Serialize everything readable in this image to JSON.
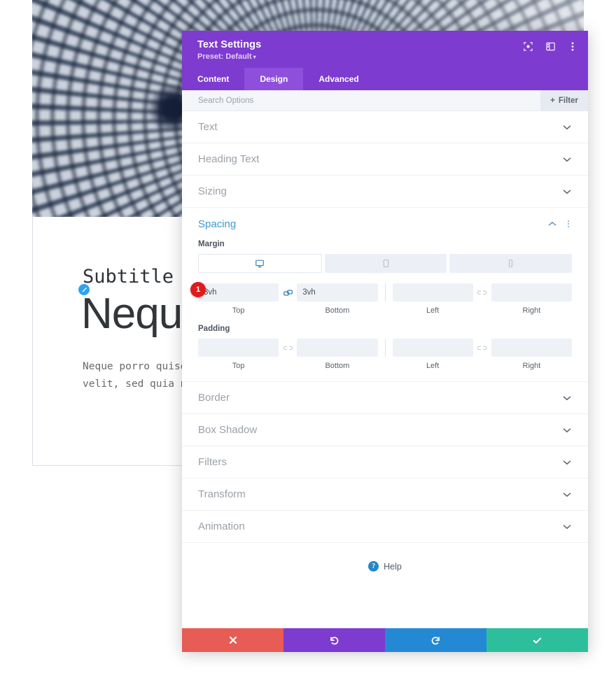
{
  "background": {
    "subtitle": "Subtitle",
    "heading": "Neque",
    "body_line1": "Neque porro quisquam est qui dolorem ipsum quia dolor sit amet, consectetur,",
    "body_line2": "velit, sed quia non numquam eius modi tempora incidunt ut labore.",
    "edit_badge_icon": "pencil-icon",
    "hero_image_alt": "blurred-dome-ceiling-photo"
  },
  "modal": {
    "title": "Text Settings",
    "preset_label": "Preset: Default",
    "preset_caret": "▾",
    "header_icons": [
      {
        "name": "focus-target-icon"
      },
      {
        "name": "layout-columns-icon"
      },
      {
        "name": "more-vertical-icon"
      }
    ],
    "tabs": [
      {
        "label": "Content",
        "active": false
      },
      {
        "label": "Design",
        "active": true
      },
      {
        "label": "Advanced",
        "active": false
      }
    ],
    "search": {
      "placeholder": "Search Options",
      "value": "",
      "filter_label": "Filter",
      "filter_plus": "+"
    },
    "sections_before": [
      {
        "label": "Text"
      },
      {
        "label": "Heading Text"
      },
      {
        "label": "Sizing"
      }
    ],
    "spacing": {
      "label": "Spacing",
      "badge": "1",
      "device_tabs": [
        {
          "name": "desktop-icon",
          "active": true
        },
        {
          "name": "tablet-icon",
          "active": false
        },
        {
          "name": "phone-icon",
          "active": false
        }
      ],
      "margin": {
        "label": "Margin",
        "top": {
          "value": "3vh",
          "caption": "Top"
        },
        "bottom": {
          "value": "3vh",
          "caption": "Bottom"
        },
        "left": {
          "value": "",
          "caption": "Left"
        },
        "right": {
          "value": "",
          "caption": "Right"
        },
        "link_tb_active": true,
        "link_lr_active": false
      },
      "padding": {
        "label": "Padding",
        "top": {
          "value": "",
          "caption": "Top"
        },
        "bottom": {
          "value": "",
          "caption": "Bottom"
        },
        "left": {
          "value": "",
          "caption": "Left"
        },
        "right": {
          "value": "",
          "caption": "Right"
        },
        "link_tb_active": false,
        "link_lr_active": false
      }
    },
    "sections_after": [
      {
        "label": "Border"
      },
      {
        "label": "Box Shadow"
      },
      {
        "label": "Filters"
      },
      {
        "label": "Transform"
      },
      {
        "label": "Animation"
      }
    ],
    "help": {
      "label": "Help",
      "icon": "question-circle-icon"
    },
    "footer_buttons": [
      {
        "name": "cancel-button",
        "icon": "close-icon",
        "color": "#e85c56"
      },
      {
        "name": "undo-button",
        "icon": "undo-icon",
        "color": "#7e3bd0"
      },
      {
        "name": "redo-button",
        "icon": "redo-icon",
        "color": "#2489d4"
      },
      {
        "name": "save-button",
        "icon": "check-icon",
        "color": "#2dbf9c"
      }
    ]
  },
  "colors": {
    "purple": "#7e3bd0",
    "purple_active_tab": "#8e4fdc",
    "blue_accent": "#3d9ad1",
    "badge_red": "#e01b1b",
    "link_blue": "#2f7fb3"
  }
}
